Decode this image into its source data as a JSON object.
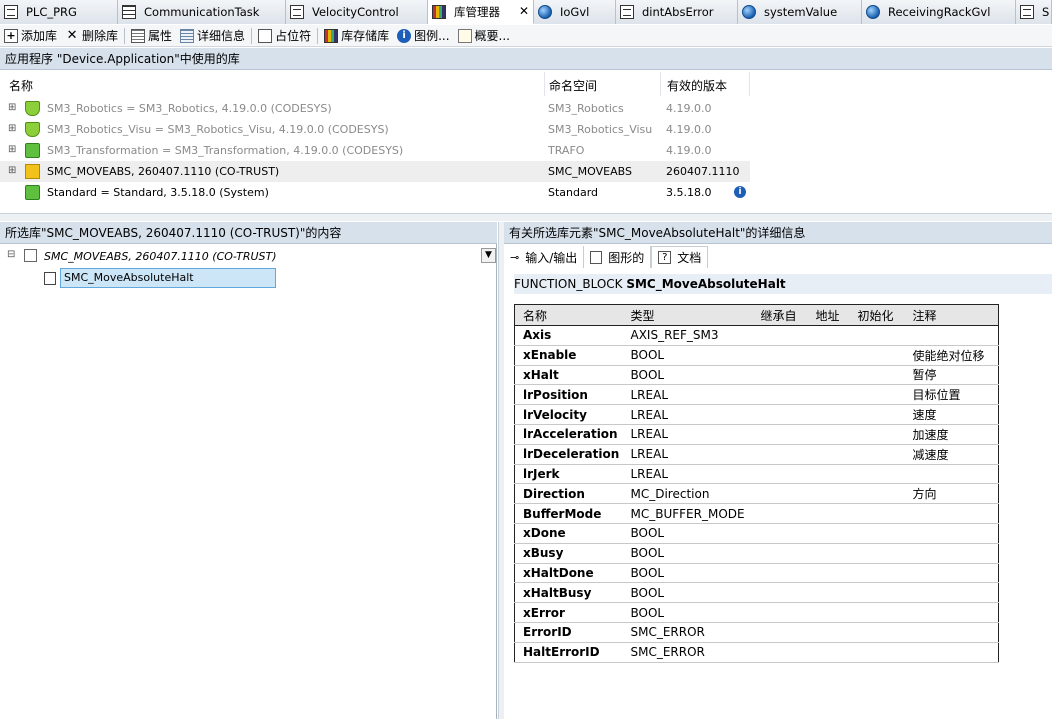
{
  "tabs": [
    {
      "label": "PLC_PRG",
      "icon": "document-icon"
    },
    {
      "label": "CommunicationTask",
      "icon": "task-icon"
    },
    {
      "label": "VelocityControl",
      "icon": "document-icon"
    },
    {
      "label": "库管理器",
      "icon": "library-icon",
      "active": true,
      "close": "✕"
    },
    {
      "label": "IoGvl",
      "icon": "globe-icon"
    },
    {
      "label": "dintAbsError",
      "icon": "document-icon"
    },
    {
      "label": "systemValue",
      "icon": "globe-icon"
    },
    {
      "label": "ReceivingRackGvl",
      "icon": "globe-icon"
    },
    {
      "label": "S",
      "icon": "document-icon"
    }
  ],
  "toolbar": {
    "add": "添加库",
    "delete": "删除库",
    "properties": "属性",
    "details": "详细信息",
    "placeholder": "占位符",
    "repository": "库存储库",
    "legend": "图例...",
    "summary": "概要..."
  },
  "top_panel": {
    "title": "应用程序 \"Device.Application\"中使用的库",
    "columns": [
      "名称",
      "命名空间",
      "有效的版本"
    ],
    "rows": [
      {
        "name": "SM3_Robotics = SM3_Robotics, 4.19.0.0 (CODESYS)",
        "namespace": "SM3_Robotics",
        "version": "4.19.0.0",
        "style": "gray",
        "icon": "shield"
      },
      {
        "name": "SM3_Robotics_Visu = SM3_Robotics_Visu, 4.19.0.0 (CODESYS)",
        "namespace": "SM3_Robotics_Visu",
        "version": "4.19.0.0",
        "style": "gray",
        "icon": "shield"
      },
      {
        "name": "SM3_Transformation = SM3_Transformation, 4.19.0.0 (CODESYS)",
        "namespace": "TRAFO",
        "version": "4.19.0.0",
        "style": "gray",
        "icon": "lock"
      },
      {
        "name": "SMC_MOVEABS, 260407.1110 (CO-TRUST)",
        "namespace": "SMC_MOVEABS",
        "version": "260407.1110",
        "style": "selected",
        "icon": "folder"
      },
      {
        "name": "Standard = Standard, 3.5.18.0 (System)",
        "namespace": "Standard",
        "version": "3.5.18.0",
        "style": "normal",
        "icon": "lock",
        "info": "i"
      }
    ]
  },
  "left_panel": {
    "title": "所选库\"SMC_MOVEABS, 260407.1110 (CO-TRUST)\"的内容",
    "root": "SMC_MOVEABS, 260407.1110 (CO-TRUST)",
    "child": "SMC_MoveAbsoluteHalt"
  },
  "right_panel": {
    "title": "有关所选库元素\"SMC_MoveAbsoluteHalt\"的详细信息",
    "subtabs": [
      "输入/输出",
      "图形的",
      "文档"
    ],
    "fb_prefix": "FUNCTION_BLOCK",
    "fb_name": "SMC_MoveAbsoluteHalt",
    "columns": [
      "名称",
      "类型",
      "继承自",
      "地址",
      "初始化",
      "注释"
    ],
    "params": [
      {
        "name": "Axis",
        "type": "AXIS_REF_SM3",
        "comment": ""
      },
      {
        "name": "xEnable",
        "type": "BOOL",
        "comment": "使能绝对位移"
      },
      {
        "name": "xHalt",
        "type": "BOOL",
        "comment": "暂停"
      },
      {
        "name": "lrPosition",
        "type": "LREAL",
        "comment": "目标位置"
      },
      {
        "name": "lrVelocity",
        "type": "LREAL",
        "comment": "速度"
      },
      {
        "name": "lrAcceleration",
        "type": "LREAL",
        "comment": "加速度"
      },
      {
        "name": "lrDeceleration",
        "type": "LREAL",
        "comment": "减速度"
      },
      {
        "name": "lrJerk",
        "type": "LREAL",
        "comment": ""
      },
      {
        "name": "Direction",
        "type": "MC_Direction",
        "comment": "方向"
      },
      {
        "name": "BufferMode",
        "type": "MC_BUFFER_MODE",
        "comment": ""
      },
      {
        "name": "xDone",
        "type": "BOOL",
        "comment": ""
      },
      {
        "name": "xBusy",
        "type": "BOOL",
        "comment": ""
      },
      {
        "name": "xHaltDone",
        "type": "BOOL",
        "comment": ""
      },
      {
        "name": "xHaltBusy",
        "type": "BOOL",
        "comment": ""
      },
      {
        "name": "xError",
        "type": "BOOL",
        "comment": ""
      },
      {
        "name": "ErrorID",
        "type": "SMC_ERROR",
        "comment": ""
      },
      {
        "name": "HaltErrorID",
        "type": "SMC_ERROR",
        "comment": ""
      }
    ]
  }
}
